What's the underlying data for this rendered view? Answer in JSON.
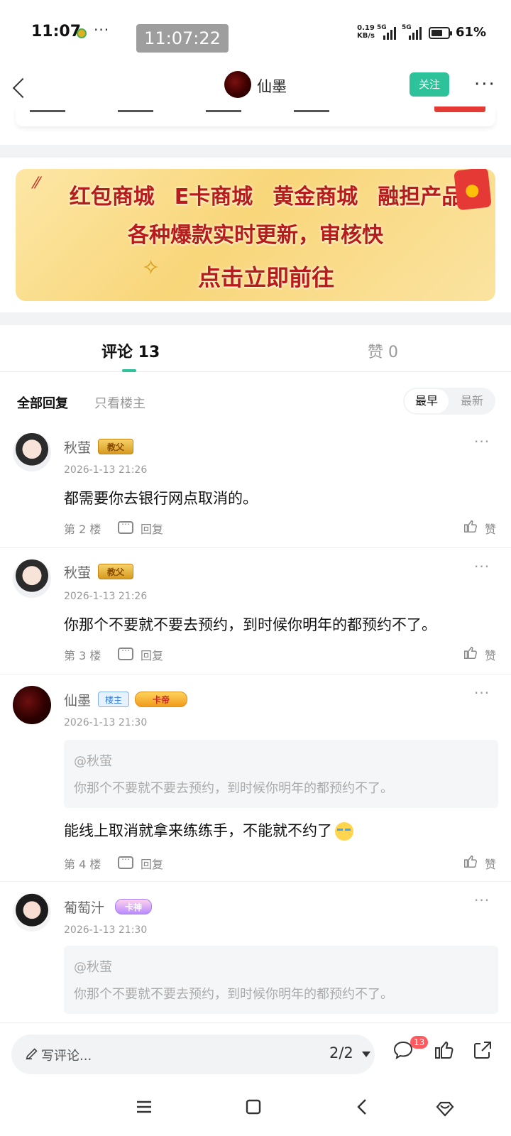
{
  "status_bar": {
    "time": "11:07",
    "more": "···",
    "overlay_time": "11:07:22",
    "net_rate_value": "0.19",
    "net_rate_unit": "KB/s",
    "sim1": "5G",
    "sim2": "5G",
    "battery_pct": "61%",
    "battery_level": 0.61
  },
  "header": {
    "author_name": "仙墨",
    "follow_label": "关注",
    "more": "···"
  },
  "banner": {
    "line1": [
      "红包商城",
      "E卡商城",
      "黄金商城",
      "融担产品"
    ],
    "line2": "各种爆款实时更新，审核快",
    "line3": "点击立即前往"
  },
  "tabs": {
    "comments_label": "评论 13",
    "likes_label": "赞 0"
  },
  "filter": {
    "all": "全部回复",
    "op_only": "只看楼主",
    "sort_early": "最早",
    "sort_new": "最新"
  },
  "comments": [
    {
      "name": "秋萤",
      "badge": "教父",
      "time": "2026-1-13 21:26",
      "text": "都需要你去银行网点取消的。",
      "floor": "第 2 楼",
      "reply": "回复",
      "like": "赞"
    },
    {
      "name": "秋萤",
      "badge": "教父",
      "time": "2026-1-13 21:26",
      "text": "你那个不要就不要去预约，到时候你明年的都预约不了。",
      "floor": "第 3 楼",
      "reply": "回复",
      "like": "赞"
    },
    {
      "name": "仙墨",
      "op_badge": "楼主",
      "badge": "卡帝",
      "time": "2026-1-13 21:30",
      "quote_at": "@秋萤",
      "quote_text": "你那个不要就不要去预约，到时候你明年的都预约不了。",
      "text": "能线上取消就拿来练练手，不能就不约了",
      "floor": "第 4 楼",
      "reply": "回复",
      "like": "赞"
    },
    {
      "name": "葡萄汁",
      "badge": "卡神",
      "time": "2026-1-13 21:30",
      "quote_at": "@秋萤",
      "quote_text": "你那个不要就不要去预约，到时候你明年的都预约不了。"
    }
  ],
  "bottom_bar": {
    "placeholder": "写评论...",
    "page_indicator": "2/2",
    "comment_count": "13"
  },
  "colors": {
    "accent": "#2dc29a",
    "badge_red": "#ff5a5f",
    "banner_text": "#b71c1c"
  },
  "icons": {
    "back": "back-arrow-icon",
    "pen": "pen-icon",
    "comment": "comment-bubble-icon",
    "like": "thumbs-up-icon",
    "share": "share-icon",
    "nav_menu": "menu-icon",
    "nav_home": "home-square-icon",
    "nav_back": "nav-back-icon",
    "nav_assist": "assistant-icon"
  }
}
